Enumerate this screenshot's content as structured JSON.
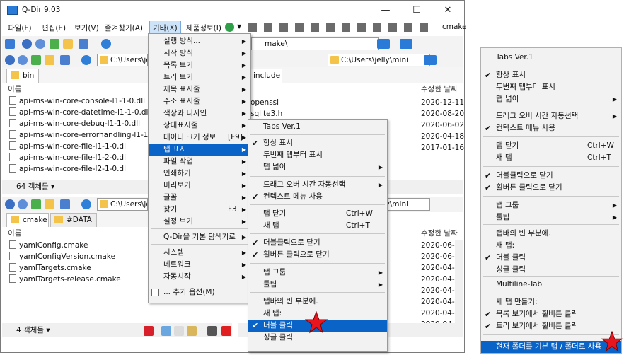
{
  "window": {
    "title": "Q-Dir 9.03",
    "min": "—",
    "max": "☐",
    "close": "✕"
  },
  "menubar": [
    "파일(F)",
    "편집(E)",
    "보기(V)",
    "즐겨찾기(A)",
    "기타(X)",
    "제품정보(I)"
  ],
  "toolbar_right_label": "cmake",
  "panes": {
    "top_left": {
      "address": "C:\\Users\\je",
      "tab": "bin",
      "header_name": "이름",
      "files": [
        "api-ms-win-core-console-l1-1-0.dll",
        "api-ms-win-core-datetime-l1-1-0.dll",
        "api-ms-win-core-debug-l1-1-0.dll",
        "api-ms-win-core-errorhandling-l1-1-0.dll",
        "api-ms-win-core-file-l1-1-0.dll",
        "api-ms-win-core-file-l1-2-0.dll",
        "api-ms-win-core-file-l2-1-0.dll"
      ],
      "status": "64 객체들 ▾"
    },
    "top_right": {
      "address_top": "make\\",
      "address": "C:\\Users\\jelly\\mini",
      "tab": "include",
      "header_date": "수정한 날짜",
      "files": [
        "openssl",
        "sqlite3.h"
      ],
      "dates": [
        "2020-12-11",
        "2020-08-20",
        "2020-06-02",
        "2020-04-18",
        "2017-01-16"
      ]
    },
    "bottom_left": {
      "address": "C:\\Users\\je",
      "tabs": [
        "cmake",
        "#DATA"
      ],
      "header_name": "이름",
      "files": [
        "yamlConfig.cmake",
        "yamlConfigVersion.cmake",
        "yamlTargets.cmake",
        "yamlTargets-release.cmake"
      ],
      "status": "4 객체들 ▾"
    },
    "bottom_right": {
      "address": "C:\\Users\\jelly\\mini",
      "header_date": "수정한 날짜",
      "dates": [
        "2020-06-2",
        "2020-06-2",
        "2020-04-1",
        "2020-04-1",
        "2020-04-1",
        "2020-04-1",
        "2020-04-1",
        "2020-04-1"
      ]
    }
  },
  "menu_extra": {
    "items": [
      {
        "label": "실행 방식...",
        "arrow": true
      },
      {
        "label": "시작 방식",
        "arrow": true
      },
      {
        "label": "목록 보기",
        "arrow": true
      },
      {
        "label": "트리 보기",
        "arrow": true
      },
      {
        "label": "제목 표시줄",
        "arrow": true
      },
      {
        "label": "주소 표시줄",
        "arrow": true
      },
      {
        "label": "색상과 디자인",
        "arrow": true
      },
      {
        "label": "상태표시줄",
        "arrow": true
      },
      {
        "label": "데이터 크기 정보",
        "shortcut": "[F9]",
        "arrow": true
      },
      {
        "label": "탭 표시",
        "arrow": true,
        "highlight": true
      },
      {
        "label": "파일 작업",
        "arrow": true
      },
      {
        "label": "인쇄하기",
        "arrow": true
      },
      {
        "label": "미리보기",
        "arrow": true
      },
      {
        "label": "글꼴",
        "arrow": true
      },
      {
        "label": "찾기",
        "shortcut": "F3",
        "arrow": true
      },
      {
        "label": "설정 보기",
        "arrow": true
      },
      {
        "label": "Q-Dir을 기본 탐색기로",
        "arrow": true
      },
      {
        "label": "시스템",
        "arrow": true
      },
      {
        "label": "네트워크",
        "arrow": true
      },
      {
        "label": "자동시작",
        "arrow": true
      },
      {
        "label": "... 추가 옵션(M)"
      }
    ]
  },
  "submenu_tabs": {
    "items": [
      {
        "label": "Tabs Ver.1"
      },
      {
        "label": "항상 표시",
        "check": true
      },
      {
        "label": "두번째 탭부터 표시"
      },
      {
        "label": "탭 넓이",
        "arrow": true
      },
      {
        "label": "드래그 오버 시간 자동선택",
        "arrow": true
      },
      {
        "label": "컨텍스트 메뉴 사용",
        "check": true
      },
      {
        "label": "탭 닫기",
        "shortcut": "Ctrl+W"
      },
      {
        "label": "새 탭",
        "shortcut": "Ctrl+T"
      },
      {
        "label": "더블클릭으로 닫기",
        "check": true
      },
      {
        "label": "휠버튼 클릭으로 닫기",
        "check": true
      },
      {
        "label": "탭 그룹",
        "arrow": true
      },
      {
        "label": "툴팁",
        "arrow": true
      },
      {
        "label": "탭바의 빈 부분에."
      },
      {
        "label": "새 탭:"
      },
      {
        "label": "더블 클릭",
        "check": true,
        "highlight": true
      },
      {
        "label": "싱글 클릭"
      }
    ]
  },
  "side_menu": {
    "items": [
      {
        "label": "Tabs Ver.1"
      },
      {
        "label": "항상 표시",
        "check": true
      },
      {
        "label": "두번째 탭부터 표시"
      },
      {
        "label": "탭 넓이",
        "arrow": true
      },
      {
        "label": "드래그 오버 시간 자동선택",
        "arrow": true
      },
      {
        "label": "컨텍스트 메뉴 사용",
        "check": true
      },
      {
        "label": "탭 닫기",
        "shortcut": "Ctrl+W"
      },
      {
        "label": "새 탭",
        "shortcut": "Ctrl+T"
      },
      {
        "label": "더블클릭으로 닫기",
        "check": true
      },
      {
        "label": "휠버튼 클릭으로 닫기",
        "check": true
      },
      {
        "label": "탭 그룹",
        "arrow": true
      },
      {
        "label": "툴팁",
        "arrow": true
      },
      {
        "label": "탭바의 빈 부분에."
      },
      {
        "label": "새 탭:"
      },
      {
        "label": "더블 클릭",
        "check": true
      },
      {
        "label": "싱글 클릭"
      },
      {
        "label": "Multiline-Tab"
      },
      {
        "label": "새 탭 만들기:"
      },
      {
        "label": "목록 보기에서 휠버튼 클릭",
        "check": true
      },
      {
        "label": "트리 보기에서 휠버튼 클릭",
        "check": true
      },
      {
        "label": "현재 폴더를 기본 탭 / 폴더로 사용",
        "highlight": true
      }
    ]
  },
  "colors": {
    "highlight": "#0a64c8",
    "star": "#e8141e",
    "folder": "#f3c34a"
  }
}
